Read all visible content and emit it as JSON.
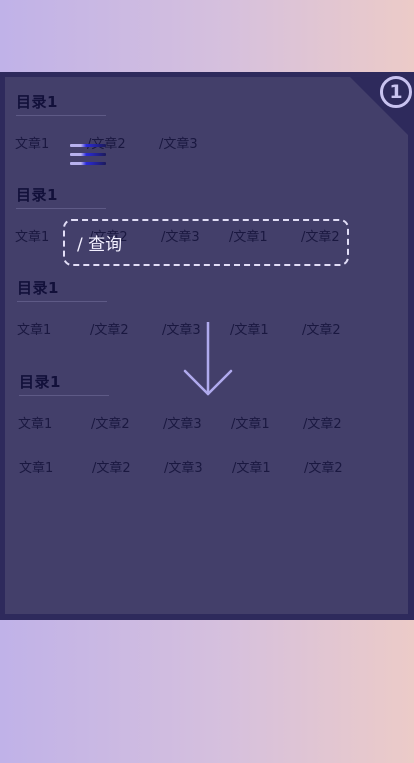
{
  "badge": {
    "number": "1"
  },
  "sections": [
    {
      "title": "目录1",
      "links": [
        "文章1",
        "/文章2",
        "/文章3"
      ]
    },
    {
      "title": "目录1",
      "links": [
        "文章1",
        "/文章2",
        "/文章3",
        "/文章1",
        "/文章2"
      ]
    },
    {
      "title": "目录1",
      "links": [
        "文章1",
        "/文章2",
        "/文章3",
        "/文章1",
        "/文章2"
      ]
    },
    {
      "title": "目录1",
      "links": [
        "文章1",
        "/文章2",
        "/文章3",
        "/文章1",
        "/文章2"
      ]
    }
  ],
  "extra_row": {
    "links": [
      "文章1",
      "/文章2",
      "/文章3",
      "/文章1",
      "/文章2"
    ]
  },
  "search": {
    "label": "/ 查询"
  },
  "colors": {
    "background_left": "#c0b2e8",
    "background_right": "#eccbc8",
    "frame": "#2e2a5c",
    "panel": "#433f6a",
    "accent": "#c9c3f0"
  },
  "icons": {
    "menu": "hamburger-menu-icon",
    "arrow": "arrow-down-icon",
    "badge": "number-badge"
  }
}
